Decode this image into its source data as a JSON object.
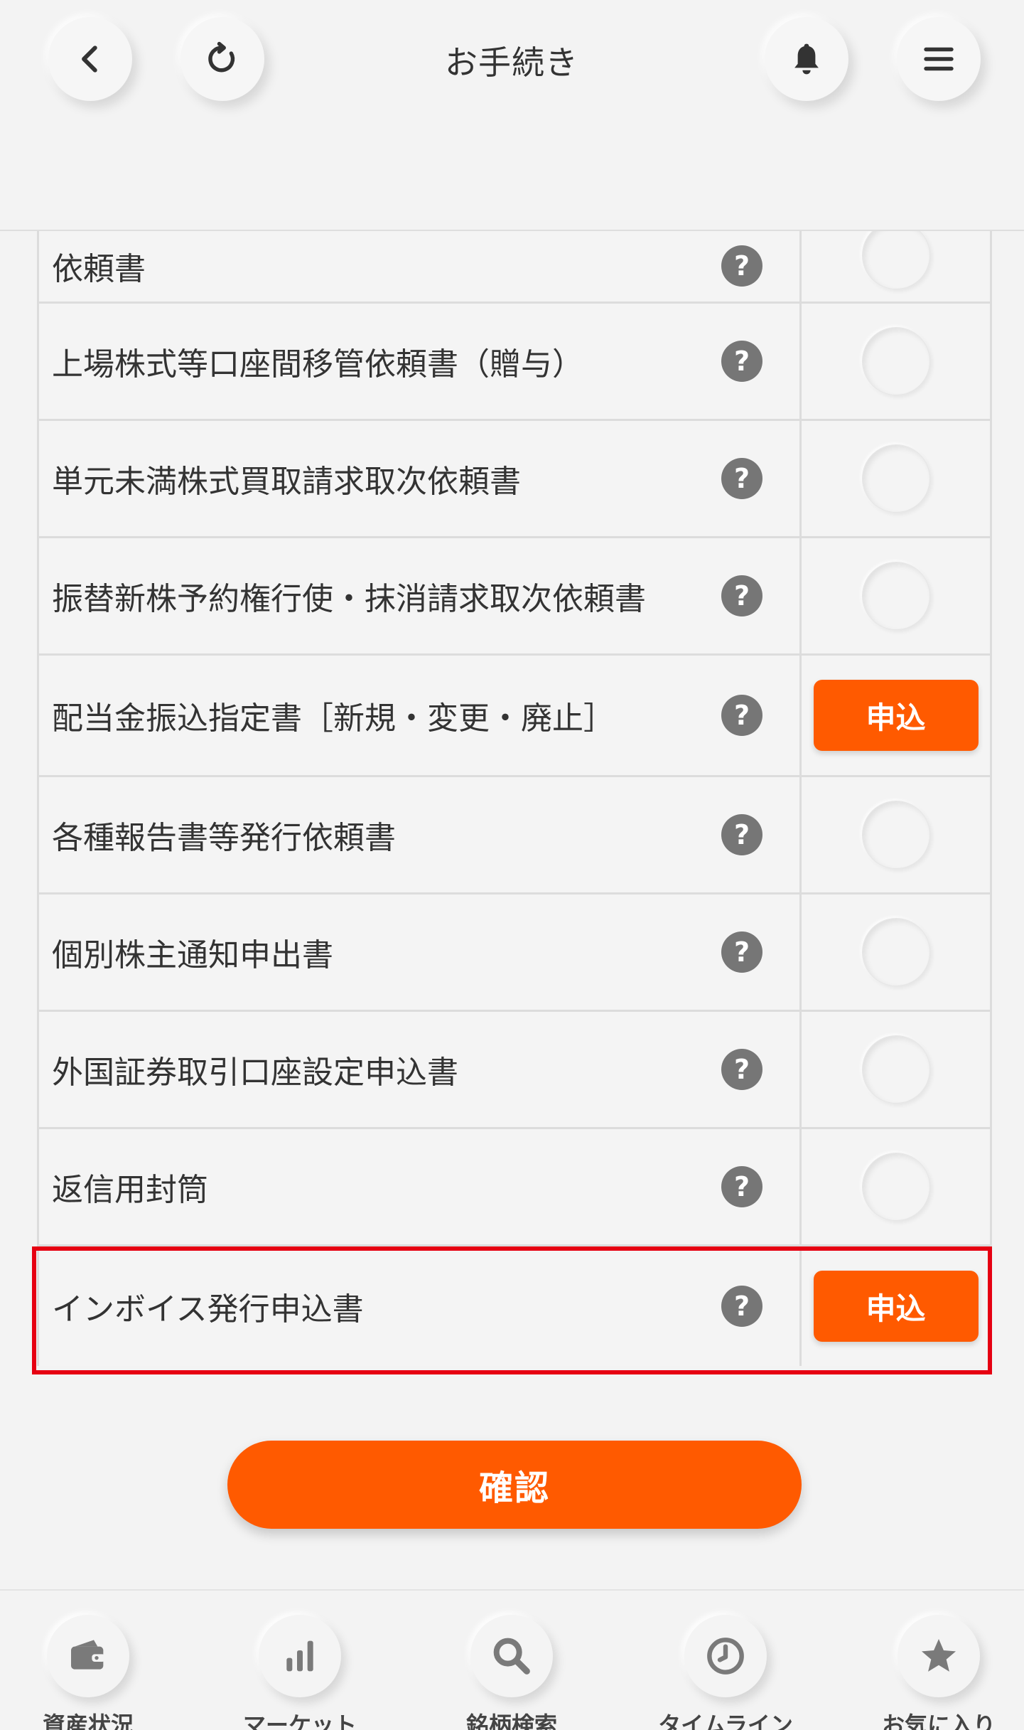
{
  "header": {
    "title": "お手続き",
    "icons": {
      "back": "chevron-left-icon",
      "reload": "reload-icon",
      "notification": "bell-icon",
      "menu": "hamburger-menu-icon"
    }
  },
  "rows": [
    {
      "label": "依頼書",
      "action": "radio"
    },
    {
      "label": "上場株式等口座間移管依頼書（贈与）",
      "action": "radio"
    },
    {
      "label": "単元未満株式買取請求取次依頼書",
      "action": "radio"
    },
    {
      "label": "振替新株予約権行使・抹消請求取次依頼書",
      "action": "radio"
    },
    {
      "label": "配当金振込指定書［新規・変更・廃止］",
      "action": "button",
      "button_label": "申込"
    },
    {
      "label": "各種報告書等発行依頼書",
      "action": "radio"
    },
    {
      "label": "個別株主通知申出書",
      "action": "radio"
    },
    {
      "label": "外国証券取引口座設定申込書",
      "action": "radio"
    },
    {
      "label": "返信用封筒",
      "action": "radio"
    },
    {
      "label": "インボイス発行申込書",
      "action": "button",
      "button_label": "申込",
      "highlighted": true
    }
  ],
  "help_icon_glyph": "?",
  "confirm_button": "確認",
  "bottom_nav": [
    {
      "label": "資産状況",
      "icon": "wallet-icon"
    },
    {
      "label": "マーケット",
      "icon": "bar-chart-icon"
    },
    {
      "label": "銘柄検索",
      "icon": "search-icon"
    },
    {
      "label": "タイムライン",
      "icon": "clock-icon"
    },
    {
      "label": "お気に入り",
      "icon": "star-icon"
    }
  ],
  "colors": {
    "accent": "#ff5a00",
    "highlight_border": "#e60012",
    "help_icon": "#767676"
  }
}
